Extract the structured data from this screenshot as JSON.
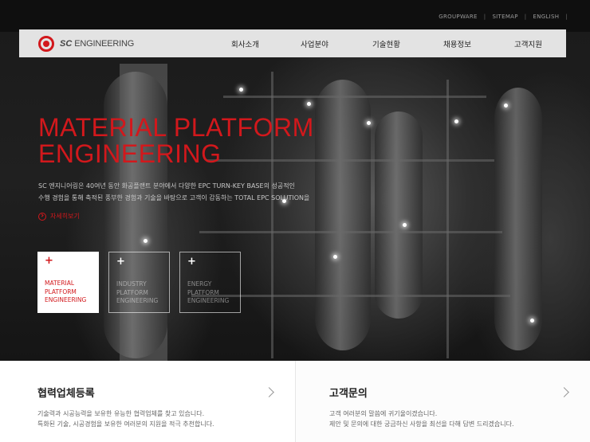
{
  "utility_links": [
    "GROUPWARE",
    "SITEMAP",
    "ENGLISH"
  ],
  "logo": {
    "sc": "SC",
    "engineering": "ENGINEERING"
  },
  "menu": [
    "회사소개",
    "사업분야",
    "기술현황",
    "채용정보",
    "고객지원"
  ],
  "hero": {
    "headline_line1": "MATERIAL PLATFORM",
    "headline_line2": "ENGINEERING",
    "desc_line1": "SC 엔지니어링은 40여년 동안 화공플랜트 분야에서 다양한 EPC TURN-KEY BASE의 성공적인",
    "desc_line2": "수행 경험을 통해 축적된 풍부한 경험과 기술을 바탕으로 고객이 감동하는 TOTAL EPC SOLUTION을",
    "more_label": "자세히보기"
  },
  "tiles": [
    {
      "plus": "+",
      "label": [
        "MATERIAL",
        "PLATFORM",
        "ENGINEERING"
      ],
      "active": true
    },
    {
      "plus": "+",
      "label": [
        "INDUSTRY",
        "PLATFORM",
        "ENGINEERING"
      ],
      "active": false
    },
    {
      "plus": "+",
      "label": [
        "ENERGY",
        "PLATFORM",
        "ENGINEERING"
      ],
      "active": false
    }
  ],
  "panels": [
    {
      "title": "협력업체등록",
      "line1": "기술력과 시공능력을 보유한 유능한 협력업체를 찾고 있습니다.",
      "line2": "특화된 기술, 시공경험을 보유한 여러분의 지원을 적극 추천합니다."
    },
    {
      "title": "고객문의",
      "line1": "고객 여러분의 말씀에 귀기울이겠습니다.",
      "line2": "제안 및 문의에 대한 궁금하신 사항을 최선을 다해 답변 드리겠습니다."
    }
  ],
  "colors": {
    "accent": "#d2181c",
    "nav_bg": "#ebebeb",
    "hero_bg": "#1a1a1a"
  },
  "icons": [
    "logo-mark-icon",
    "circle-arrow-icon",
    "plus-icon",
    "chevron-right-icon"
  ]
}
